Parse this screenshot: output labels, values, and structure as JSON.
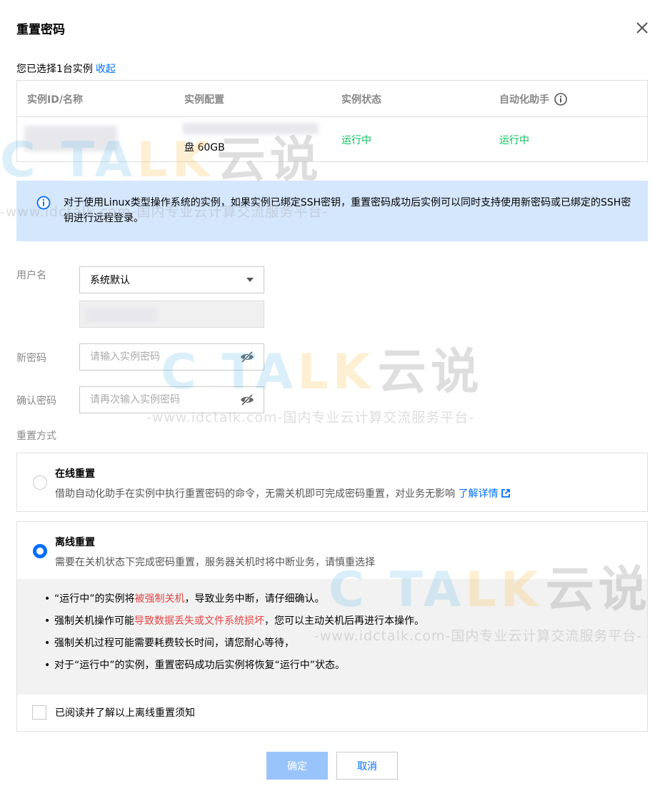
{
  "dialog": {
    "title": "重置密码",
    "selected_text": "您已选择1台实例",
    "collapse_link": "收起"
  },
  "table": {
    "headers": [
      "实例ID/名称",
      "实例配置",
      "实例状态",
      "自动化助手"
    ],
    "rows": [
      {
        "config": "盘 60GB",
        "status": "运行中",
        "assistant": "运行中"
      }
    ]
  },
  "notice": {
    "text": "对于使用Linux类型操作系统的实例，如果实例已绑定SSH密钥，重置密码成功后实例可以同时支持使用新密码或已绑定的SSH密钥进行远程登录。"
  },
  "form": {
    "username_label": "用户名",
    "username_value": "系统默认",
    "new_password_label": "新密码",
    "new_password_placeholder": "请输入实例密码",
    "confirm_password_label": "确认密码",
    "confirm_password_placeholder": "请再次输入实例密码",
    "reset_method_label": "重置方式"
  },
  "online": {
    "title": "在线重置",
    "desc": "借助自动化助手在实例中执行重置密码的命令，无需关机即可完成密码重置，对业务无影响",
    "link": "了解详情"
  },
  "offline": {
    "title": "离线重置",
    "desc": "需要在关机状态下完成密码重置，服务器关机时将中断业务，请慎重选择",
    "notes": [
      {
        "pre": "“运行中”的实例将",
        "red": "被强制关机",
        "post": "，导致业务中断，请仔细确认。"
      },
      {
        "pre": "强制关机操作可能",
        "red": "导致数据丢失或文件系统损坏",
        "post": "，您可以主动关机后再进行本操作。"
      },
      {
        "pre": "强制关机过程可能需要耗费较长时间，请您耐心等待，",
        "red": "",
        "post": ""
      },
      {
        "pre": "对于“运行中”的实例，重置密码成功后实例将恢复“运行中”状态。",
        "red": "",
        "post": ""
      }
    ],
    "agree": "已阅读并了解以上离线重置须知"
  },
  "buttons": {
    "ok": "确定",
    "cancel": "取消"
  },
  "watermark": {
    "logo_a": "TA",
    "logo_b": "LK",
    "logo_cn": "云说",
    "sub": "-www.idctalk.com-国内专业云计算交流服务平台-"
  },
  "colors": {
    "accent": "#006eff",
    "success": "#0abf5b",
    "danger": "#e54545",
    "notice_bg": "#d5e7fd"
  }
}
